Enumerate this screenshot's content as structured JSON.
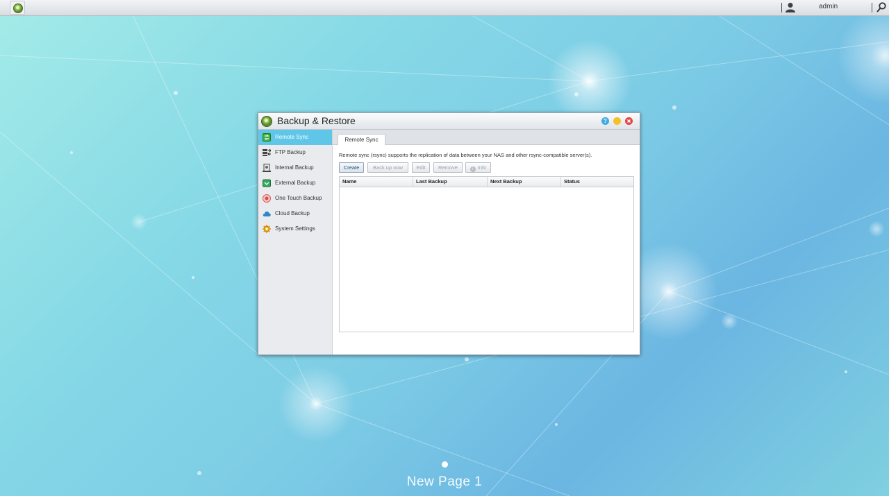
{
  "topbar": {
    "user_name": "admin"
  },
  "window": {
    "title": "Backup & Restore",
    "help_label": "?"
  },
  "sidebar": {
    "items": [
      {
        "label": "Remote Sync",
        "icon": "remote-sync-icon",
        "active": true
      },
      {
        "label": "FTP Backup",
        "icon": "ftp-backup-icon"
      },
      {
        "label": "Internal Backup",
        "icon": "internal-backup-icon"
      },
      {
        "label": "External Backup",
        "icon": "external-backup-icon"
      },
      {
        "label": "One Touch Backup",
        "icon": "one-touch-backup-icon"
      },
      {
        "label": "Cloud Backup",
        "icon": "cloud-backup-icon"
      },
      {
        "label": "System Settings",
        "icon": "system-settings-icon"
      }
    ]
  },
  "main": {
    "tab_label": "Remote Sync",
    "description": "Remote sync (rsync) supports the replication of data between your NAS and other rsync-compatible server(s).",
    "buttons": {
      "create": "Create",
      "backup_now": "Back up now",
      "edit": "Edit",
      "remove": "Remove",
      "info": "Info",
      "info_glyph": "i"
    },
    "table": {
      "columns": [
        "Name",
        "Last Backup",
        "Next Backup",
        "Status"
      ],
      "rows": []
    }
  },
  "desktop": {
    "page_label": "New Page 1"
  },
  "colors": {
    "accent": "#5fc6e8",
    "help": "#3cabe0",
    "minimize": "#f2c228",
    "close": "#e24545"
  }
}
